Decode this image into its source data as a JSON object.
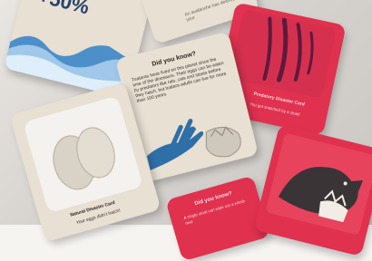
{
  "cards": {
    "percent_card": {
      "value": "+50%"
    },
    "top_card": {
      "text": "An avalanche has destroyed your"
    },
    "did_you_know_card": {
      "title": "Did you know?",
      "body": "Tuataras have lived on this planet since the time of the dinosaurs. Their eggs can be eaten by predators like rats, cats and stoats before they hatch, but tuatara adults can live for more than 100 years."
    },
    "predatory_card": {
      "title": "Predatory Disaster Card",
      "subtitle": "You got snatched by a stoat!"
    },
    "egg_card": {
      "title": "Natural Disaster Card",
      "subtitle": "Your eggs didn't hatch!"
    },
    "bottom_card": {
      "title": "Did you know?",
      "text": "A single stoat can wipe out a whole nest"
    }
  },
  "colors": {
    "beige": "#e7e0d3",
    "red": "#e0314f",
    "blue": "#2f6fa8",
    "navy": "#23406a"
  }
}
